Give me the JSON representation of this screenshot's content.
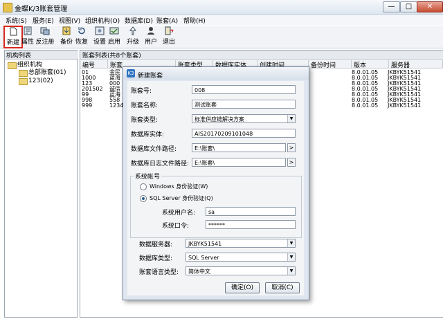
{
  "window": {
    "title": "金蝶K/3账套管理",
    "min": "—",
    "max": "□",
    "close": "✕"
  },
  "menu": [
    "系统(S)",
    "服务(E)",
    "视图(V)",
    "组织机构(O)",
    "数据库(D)",
    "账套(A)",
    "帮助(H)"
  ],
  "toolbar": [
    {
      "label": "新建",
      "icon": "new-icon"
    },
    {
      "label": "属性",
      "icon": "properties-icon"
    },
    {
      "label": "反注册",
      "icon": "unregister-icon"
    },
    {
      "label": "备份",
      "icon": "backup-icon"
    },
    {
      "label": "恢复",
      "icon": "restore-icon"
    },
    {
      "label": "设置",
      "icon": "settings-icon"
    },
    {
      "label": "启用",
      "icon": "enable-icon"
    },
    {
      "label": "升级",
      "icon": "upgrade-icon"
    },
    {
      "label": "用户",
      "icon": "user-icon"
    },
    {
      "label": "退出",
      "icon": "exit-icon"
    }
  ],
  "left_panel": {
    "title": "机构列表",
    "tree": {
      "root": "组织机构",
      "children": [
        "总部账套(01)",
        "123(02)"
      ]
    }
  },
  "right_panel": {
    "title": "账套列表(共8个账套)",
    "columns": [
      "编号",
      "账套",
      "账套类型",
      "数据库实体",
      "创建时间",
      "备份时间",
      "版本",
      "服务器"
    ],
    "rows": [
      {
        "id": "01",
        "name": "金民",
        "version": "8.0.01.05",
        "server": "JKBYK51541"
      },
      {
        "id": "1000",
        "name": "蓝海",
        "version": "8.0.01.05",
        "server": "JKBYK51541"
      },
      {
        "id": "123",
        "name": "000",
        "version": "8.0.01.05",
        "server": "JKBYK51541"
      },
      {
        "id": "201502",
        "name": "诚信",
        "version": "8.0.01.05",
        "server": "JKBYK51541"
      },
      {
        "id": "99",
        "name": "蓝海",
        "version": "8.0.01.05",
        "server": "JKBYK51541"
      },
      {
        "id": "998",
        "name": "558",
        "version": "8.0.01.05",
        "server": "JKBYK51541"
      },
      {
        "id": "999",
        "name": "1234",
        "version": "8.0.01.05",
        "server": "JKBYK51541"
      }
    ]
  },
  "dialog": {
    "title": "新建账套",
    "icon_text": "K3",
    "fields": {
      "account_no": {
        "label": "账套号:",
        "value": "008"
      },
      "account_name": {
        "label": "账套名称:",
        "value": "测试账套"
      },
      "account_type": {
        "label": "账套类型:",
        "value": "标准供应链解决方案"
      },
      "db_instance": {
        "label": "数据库实体:",
        "value": "AIS20170209101048"
      },
      "db_file_path": {
        "label": "数据库文件路径:",
        "value": "E:\\账套\\"
      },
      "db_log_path": {
        "label": "数据库日志文件路径:",
        "value": "E:\\账套\\"
      }
    },
    "system_account": {
      "label": "系统帐号",
      "windows_auth": "Windows 身份验证(W)",
      "sql_auth": "SQL Server 身份验证(Q)",
      "username_label": "系统用户名:",
      "username": "sa",
      "password_label": "系统口令:",
      "password": "******"
    },
    "db_server": {
      "label": "数据服务器:",
      "value": "JKBYK51541"
    },
    "db_type": {
      "label": "数据库类型:",
      "value": "SQL Server"
    },
    "language": {
      "label": "账套语言类型:",
      "value": "简体中文"
    },
    "ok": "确定(O)",
    "cancel": "取消(C)",
    "browse": ">"
  },
  "colors": {
    "highlight": "#d8281e",
    "dialog_bg": "#dfe6f0",
    "folder": "#efd67a"
  }
}
